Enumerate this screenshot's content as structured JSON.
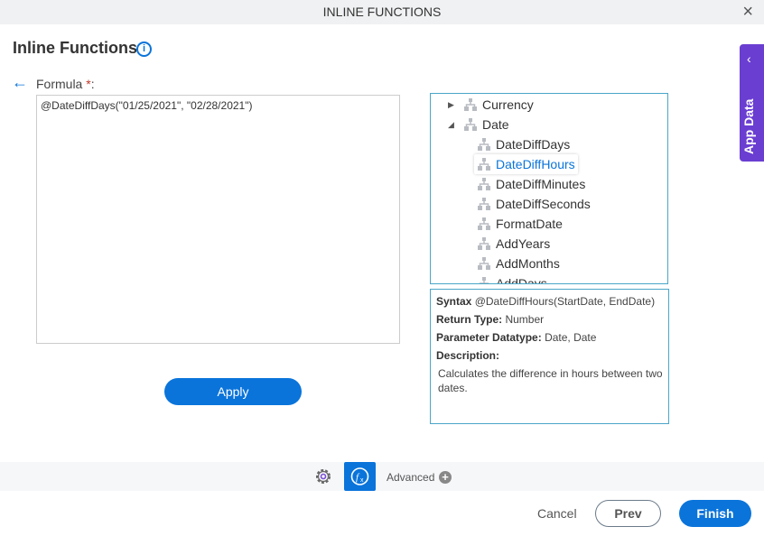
{
  "window": {
    "title": "INLINE FUNCTIONS",
    "close_label": "×"
  },
  "page": {
    "title": "Inline Functions"
  },
  "formula": {
    "label": "Formula",
    "required_mark": "*",
    "colon": ":",
    "value": "@DateDiffDays(\"01/25/2021\", \"02/28/2021\")"
  },
  "apply_label": "Apply",
  "tree": {
    "items": [
      {
        "label": "Currency",
        "level": 0,
        "expander": "collapsed"
      },
      {
        "label": "Date",
        "level": 0,
        "expander": "expanded"
      },
      {
        "label": "DateDiffDays",
        "level": 1
      },
      {
        "label": "DateDiffHours",
        "level": 1,
        "selected": true
      },
      {
        "label": "DateDiffMinutes",
        "level": 1
      },
      {
        "label": "DateDiffSeconds",
        "level": 1
      },
      {
        "label": "FormatDate",
        "level": 1
      },
      {
        "label": "AddYears",
        "level": 1
      },
      {
        "label": "AddMonths",
        "level": 1
      },
      {
        "label": "AddDays",
        "level": 1
      }
    ]
  },
  "details": {
    "syntax_label": "Syntax",
    "syntax": "@DateDiffHours(StartDate, EndDate)",
    "return_label": "Return Type:",
    "return_type": "Number",
    "param_label": "Parameter Datatype:",
    "param_types": "Date, Date",
    "desc_label": "Description:",
    "description": "Calculates the difference in hours between two dates."
  },
  "side_panel": {
    "label": "App Data"
  },
  "toolbar": {
    "advanced_label": "Advanced"
  },
  "footer": {
    "cancel": "Cancel",
    "prev": "Prev",
    "finish": "Finish"
  },
  "colors": {
    "accent": "#0a74da",
    "side_panel": "#6a3ed1",
    "border": "#4aa6c8"
  }
}
